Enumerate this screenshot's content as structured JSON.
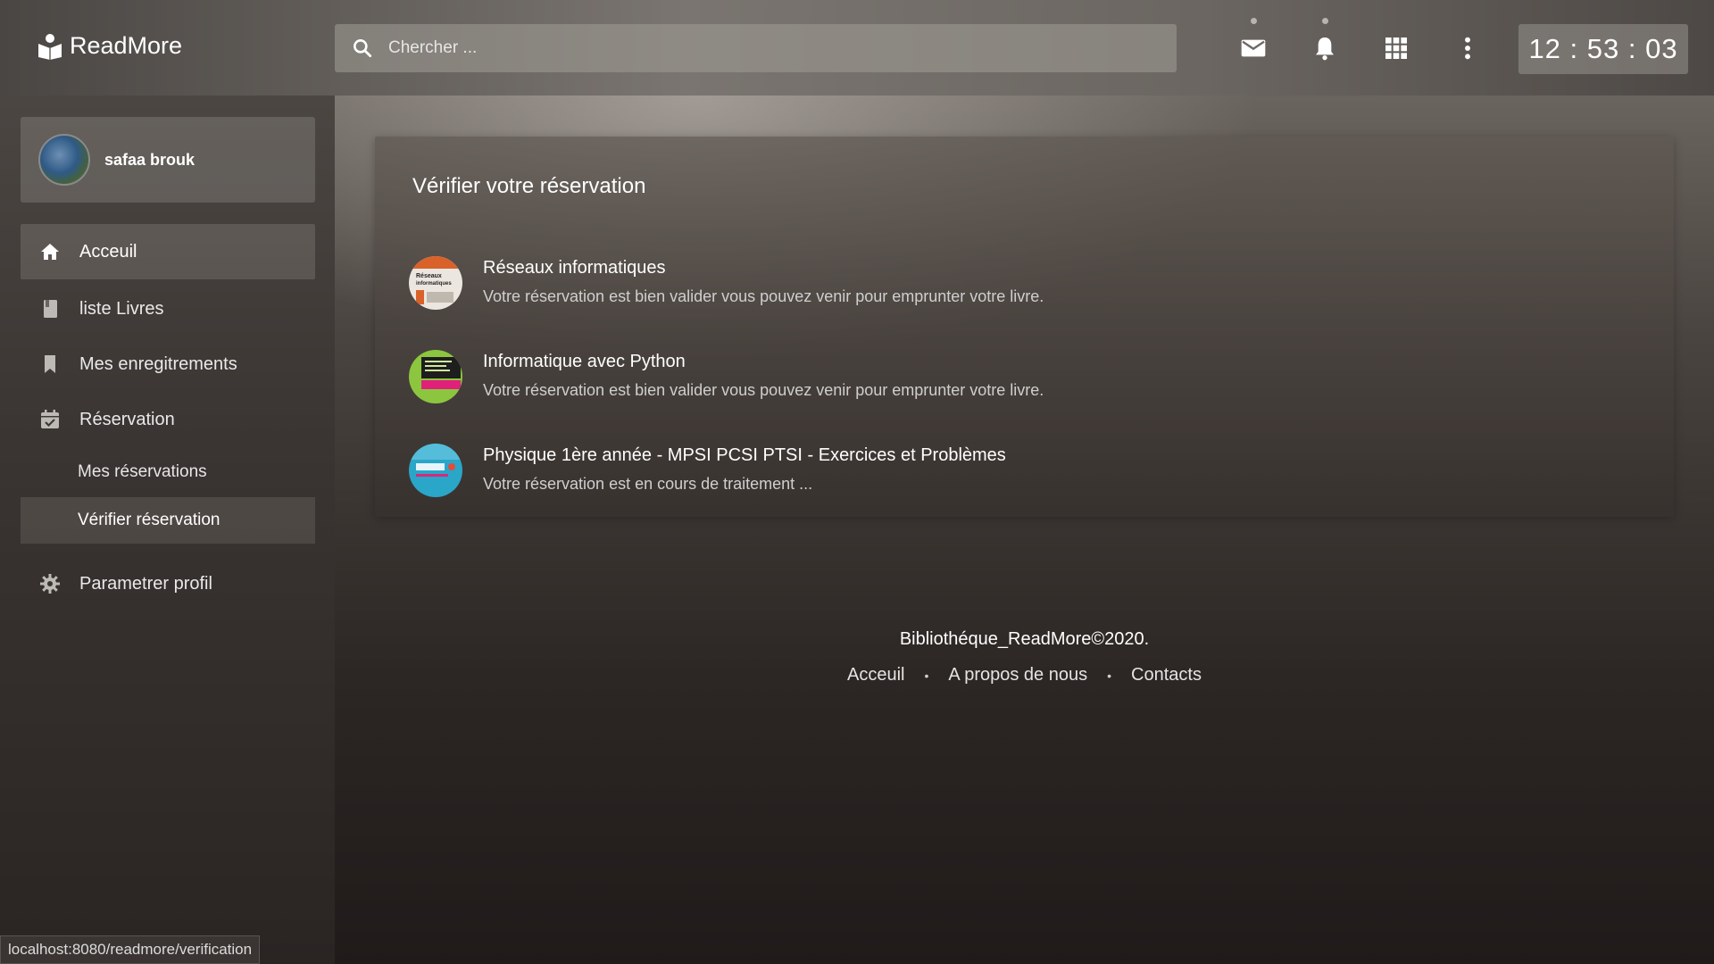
{
  "app": {
    "brand": "ReadMore",
    "search_placeholder": "Chercher ...",
    "clock": "12 : 53 : 03"
  },
  "topbar": {
    "icons": [
      "mail-icon",
      "bell-icon",
      "apps-grid-icon",
      "more-vert-icon"
    ]
  },
  "sidebar": {
    "user_name": "safaa brouk",
    "items": [
      {
        "label": "Acceuil",
        "icon": "home-icon"
      },
      {
        "label": "liste Livres",
        "icon": "book-icon"
      },
      {
        "label": "Mes enregitrements",
        "icon": "bookmark-icon"
      },
      {
        "label": "Réservation",
        "icon": "calendar-check-icon"
      },
      {
        "label": "Parametrer profil",
        "icon": "gear-icon"
      }
    ],
    "sub_items": [
      {
        "label": "Mes réservations"
      },
      {
        "label": "Vérifier réservation"
      }
    ]
  },
  "main": {
    "card_title": "Vérifier votre réservation",
    "reservations": [
      {
        "title": "Réseaux informatiques",
        "message": "Votre réservation est bien valider vous pouvez venir pour emprunter votre livre.",
        "cover_color": "#e9e4de",
        "cover_label": "Réseaux informatiques"
      },
      {
        "title": "Informatique avec Python",
        "message": "Votre réservation est bien valider vous pouvez venir pour emprunter votre livre.",
        "cover_color": "#8cc63f",
        "cover_label": "INFORMATIQUE AVEC PYTHON"
      },
      {
        "title": "Physique 1ère année - MPSI PCSI PTSI - Exercices et Problèmes",
        "message": "Votre réservation est en cours de traitement ...",
        "cover_color": "#2aa6c9",
        "cover_label": "PHYSIQUE"
      }
    ]
  },
  "footer": {
    "copyright": "Bibliothéque_ReadMore©2020.",
    "links": [
      "Acceuil",
      "A propos de nous",
      "Contacts"
    ]
  },
  "status_url": "localhost:8080/readmore/verification"
}
